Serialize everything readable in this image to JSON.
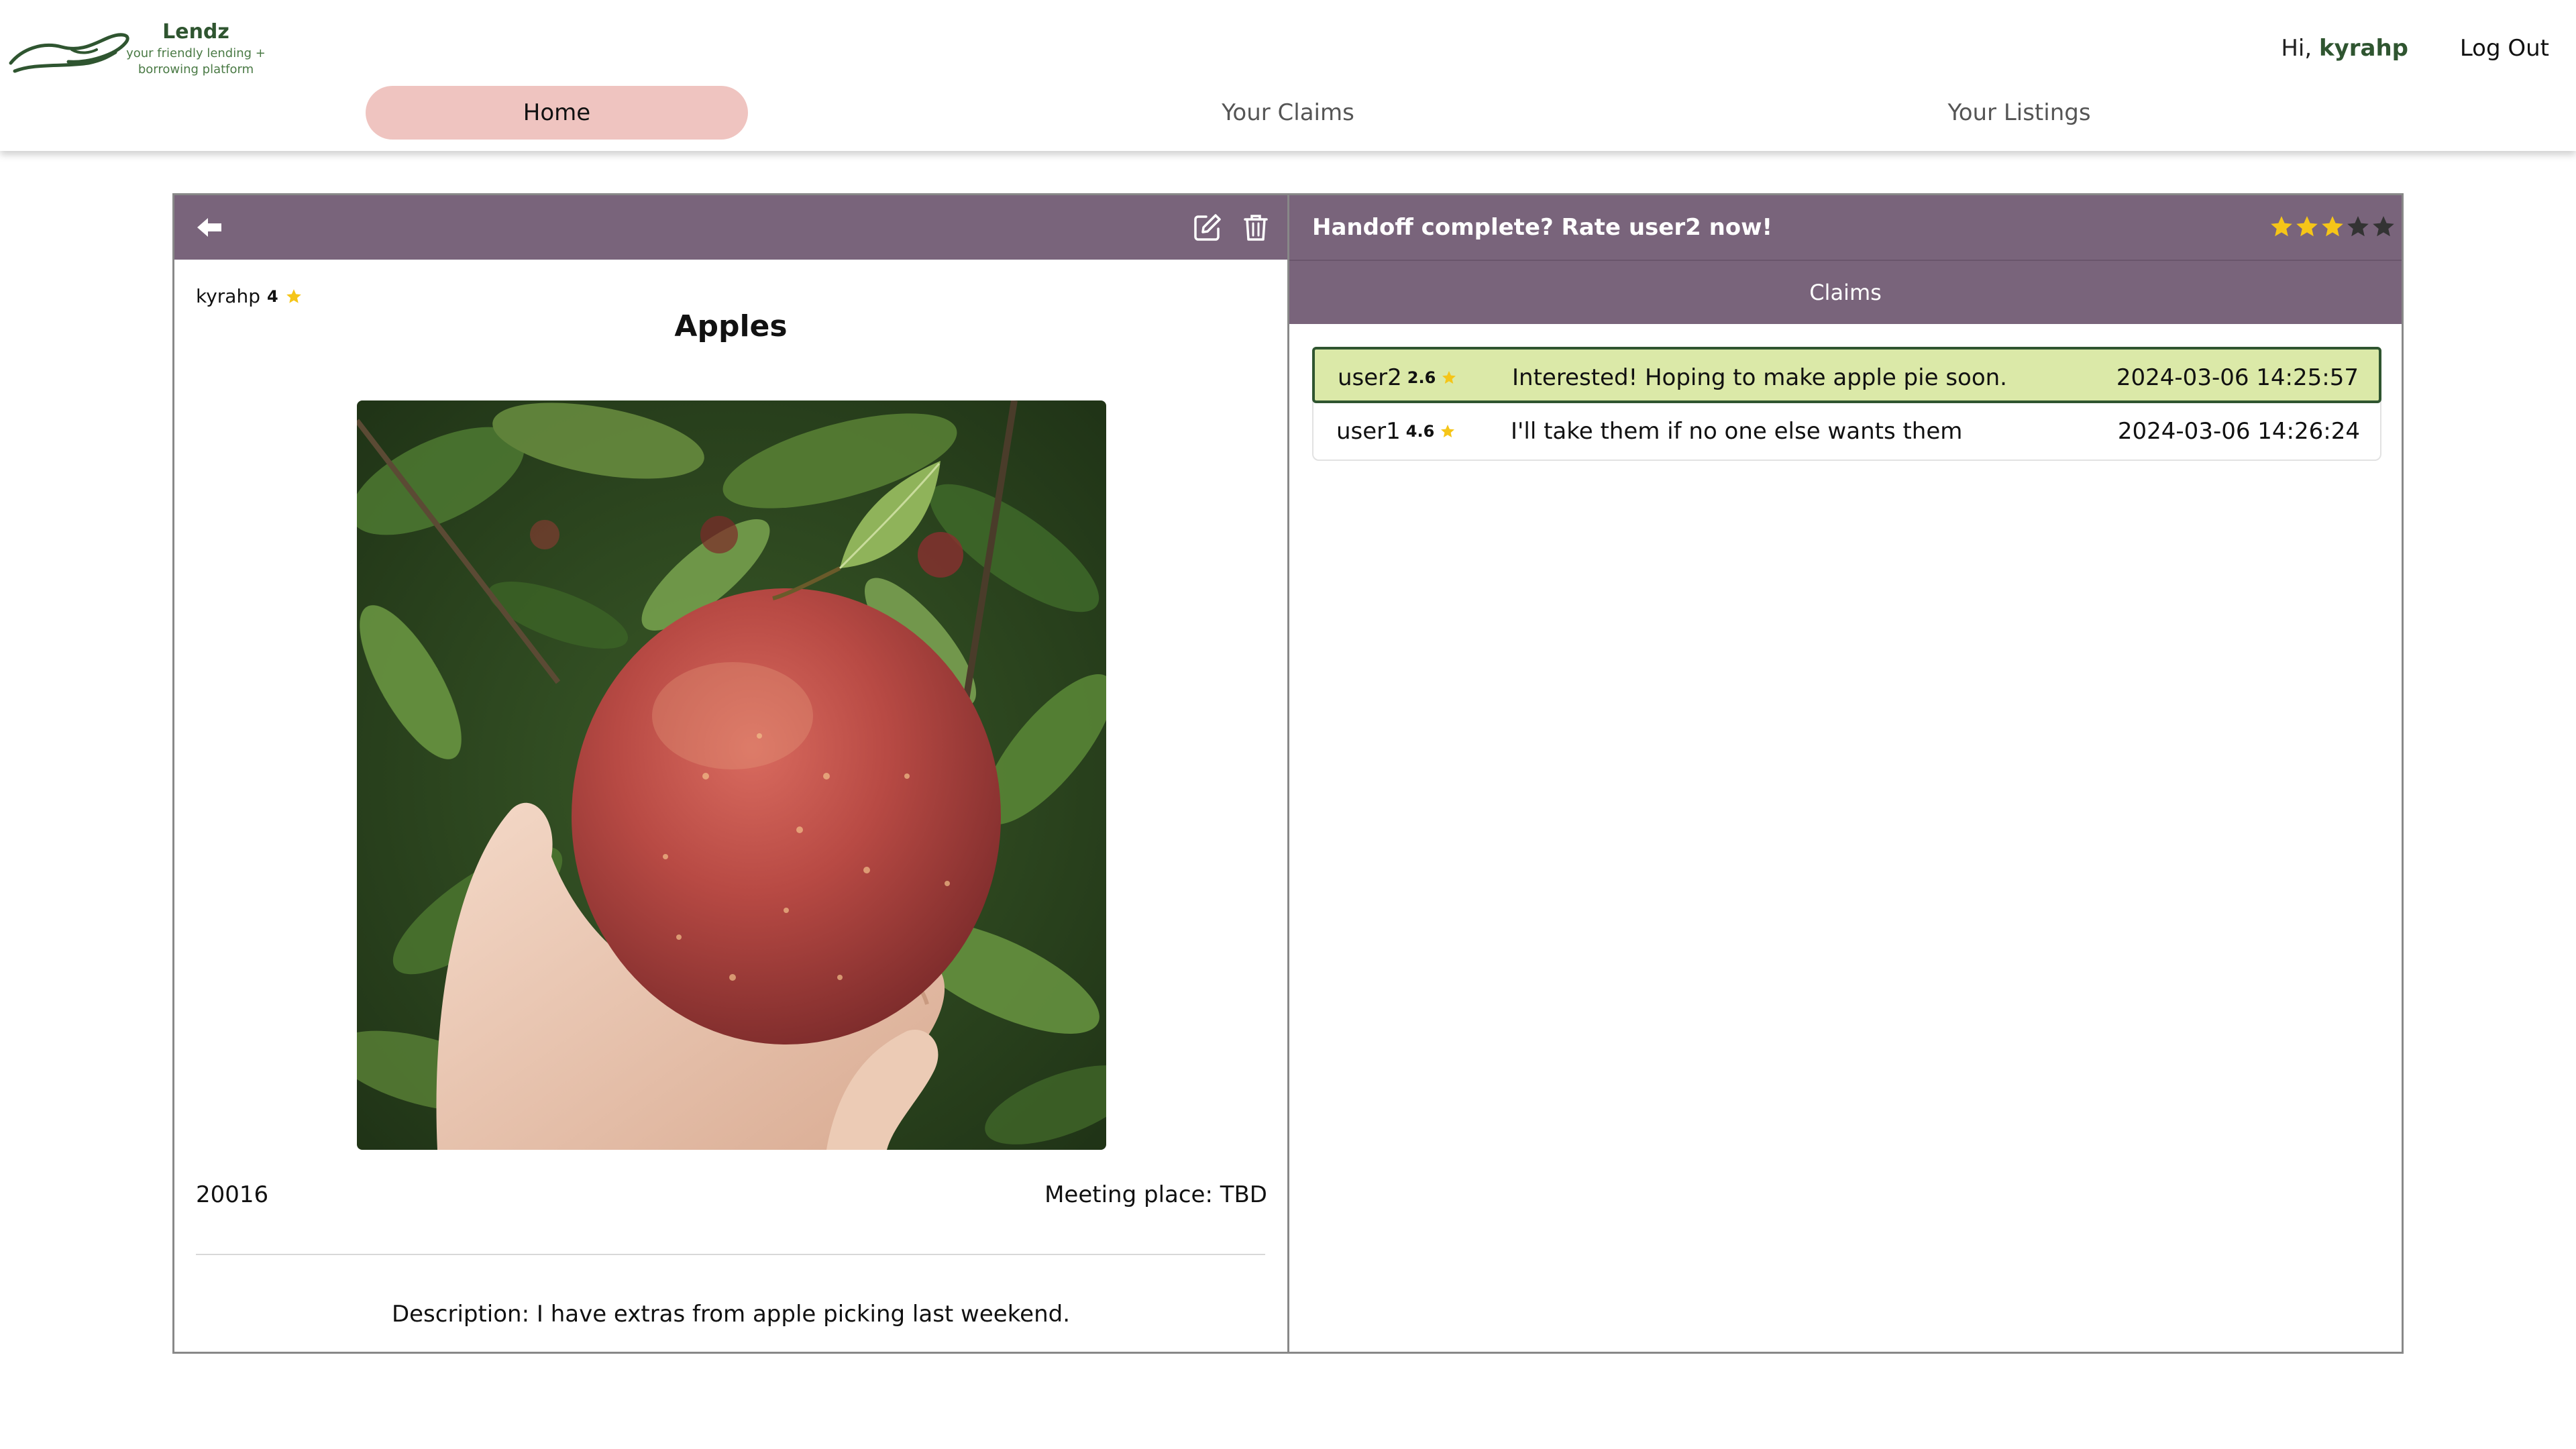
{
  "colors": {
    "brand_green": "#2f5530",
    "header_purple": "#79647b",
    "active_tab": "#efc4c0",
    "selected_claim": "#dbe9a8",
    "star_gold": "#f5c518",
    "star_dark": "#333333"
  },
  "header": {
    "logo": {
      "name": "Lendz",
      "tagline_line1": "your friendly lending +",
      "tagline_line2": "borrowing platform"
    },
    "greeting_prefix": "Hi,",
    "username": "kyrahp",
    "logout_label": "Log Out",
    "tabs": [
      {
        "label": "Home",
        "active": true
      },
      {
        "label": "Your Claims",
        "active": false
      },
      {
        "label": "Your Listings",
        "active": false
      }
    ]
  },
  "listing": {
    "toolbar_icons": [
      "arrow-left-icon",
      "edit-icon",
      "trash-icon"
    ],
    "owner": "kyrahp",
    "owner_rating": "4",
    "title": "Apples",
    "zip": "20016",
    "meeting_place": "Meeting place: TBD",
    "description": "Description: I have extras from apple picking last weekend."
  },
  "rating_prompt": {
    "text": "Handoff complete? Rate user2 now!",
    "stars_filled": 3,
    "stars_total": 5
  },
  "claims": {
    "title": "Claims",
    "rows": [
      {
        "user": "user2",
        "rating": "2.6",
        "message": "Interested! Hoping to make apple pie soon.",
        "timestamp": "2024-03-06 14:25:57",
        "selected": true
      },
      {
        "user": "user1",
        "rating": "4.6",
        "message": "I'll take them if no one else wants them",
        "timestamp": "2024-03-06 14:26:24",
        "selected": false
      }
    ]
  }
}
